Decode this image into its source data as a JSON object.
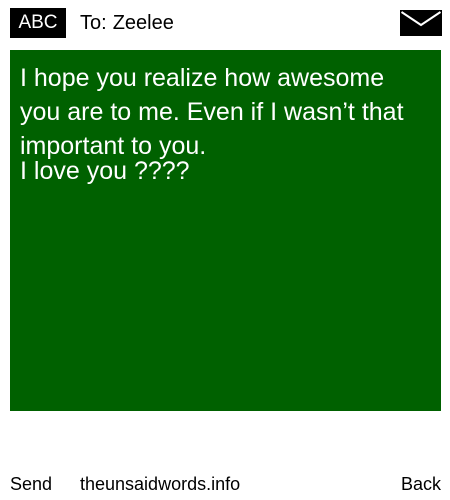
{
  "header": {
    "input_mode": "ABC",
    "to_label": "To:",
    "recipient": "Zeelee",
    "envelope_icon": "envelope-icon"
  },
  "message": {
    "lines": [
      "I hope you realize how awesome you are to me. Even if I wasn’t that important to you.",
      "I love you ????"
    ]
  },
  "footer": {
    "send_label": "Send",
    "site_label": "theunsaidwords.info",
    "back_label": "Back"
  },
  "colors": {
    "message_background": "#006100",
    "message_text": "#ffffff",
    "badge_background": "#000000"
  }
}
